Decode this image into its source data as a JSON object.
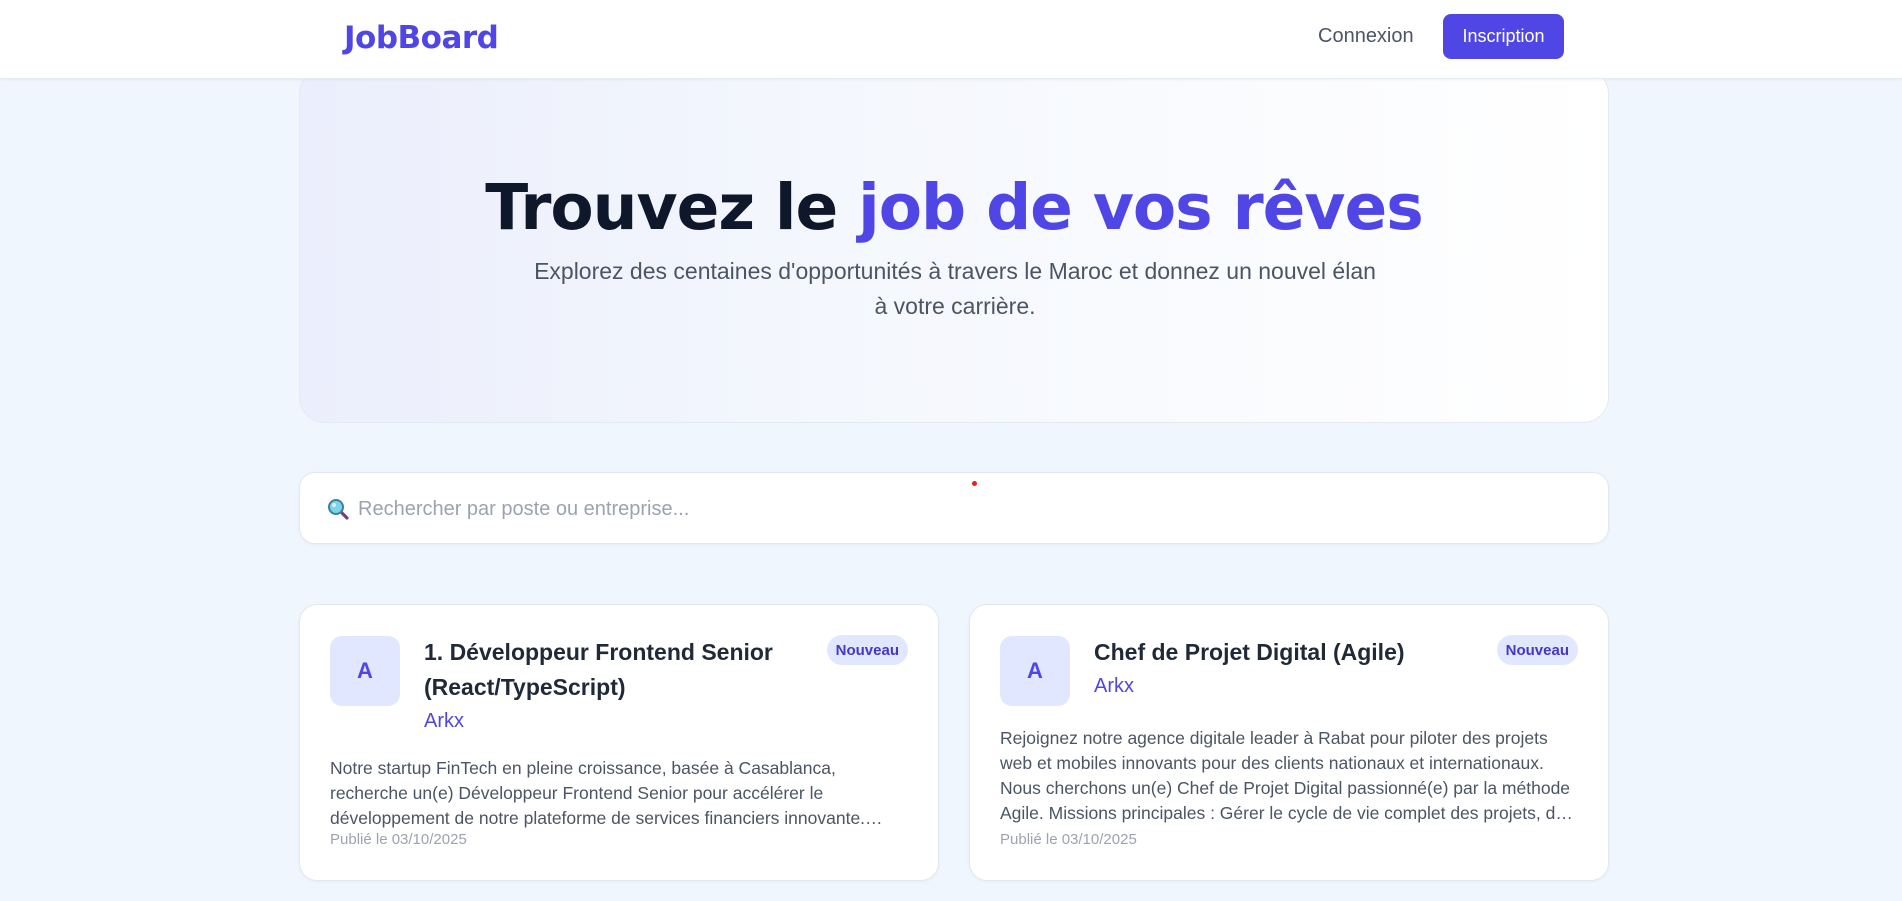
{
  "header": {
    "logo": "JobBoard",
    "login_label": "Connexion",
    "signup_label": "Inscription"
  },
  "hero": {
    "title_plain": "Trouvez le ",
    "title_accent": "job de vos rêves",
    "subtitle": "Explorez des centaines d'opportunités à travers le Maroc et donnez un nouvel élan à votre carrière."
  },
  "search": {
    "placeholder": "Rechercher par poste ou entreprise...",
    "value": "",
    "icon": "search-icon"
  },
  "jobs": [
    {
      "avatar_letter": "A",
      "title": "1. Développeur Frontend Senior (React/TypeScript)",
      "company": "Arkx",
      "badge": "Nouveau",
      "description": "Notre startup FinTech en pleine croissance, basée à Casablanca, recherche un(e) Développeur Frontend Senior pour accélérer le développement de notre plateforme de services financiers innovante. Missions principales : - Concevoir et développer des interfaces utilisateur performantes",
      "date": "Publié le 03/10/2025"
    },
    {
      "avatar_letter": "A",
      "title": "Chef de Projet Digital (Agile)",
      "company": "Arkx",
      "badge": "Nouveau",
      "description": "Rejoignez notre agence digitale leader à Rabat pour piloter des projets web et mobiles innovants pour des clients nationaux et internationaux. Nous cherchons un(e) Chef de Projet Digital passionné(e) par la méthode Agile. Missions principales : Gérer le cycle de vie complet des projets, de la conception à la livraison",
      "date": "Publié le 03/10/2025"
    }
  ],
  "colors": {
    "accent": "#4f46e5",
    "background": "#f0f6fd",
    "badge_bg": "#e0e7ff"
  }
}
